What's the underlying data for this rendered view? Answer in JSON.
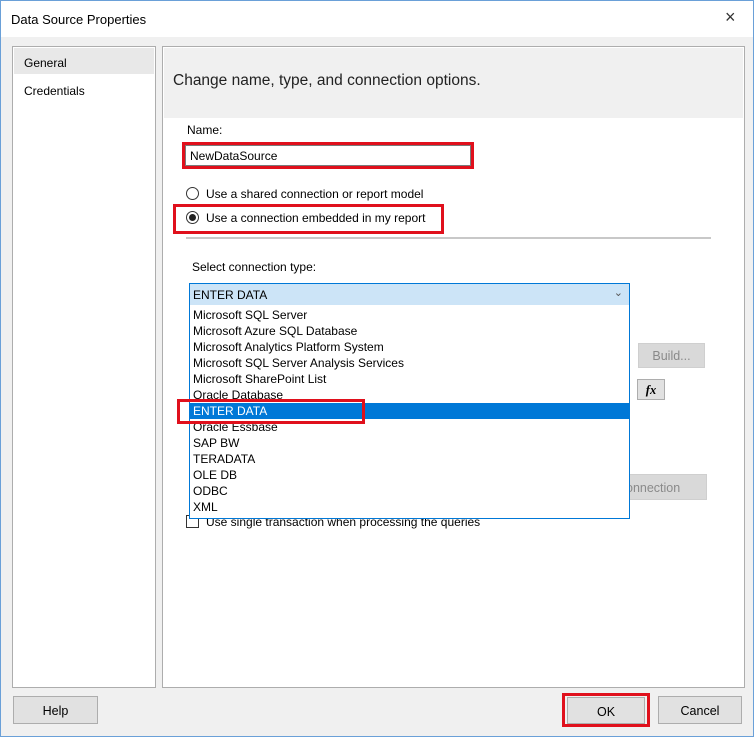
{
  "window": {
    "title": "Data Source Properties",
    "close_icon": "×"
  },
  "nav": {
    "items": [
      {
        "label": "General"
      },
      {
        "label": "Credentials"
      }
    ]
  },
  "header": {
    "text": "Change name, type, and connection options."
  },
  "name": {
    "label": "Name:",
    "value": "NewDataSource"
  },
  "radios": [
    {
      "label": "Use a shared connection or report model",
      "checked": false
    },
    {
      "label": "Use a connection embedded in my report",
      "checked": true
    }
  ],
  "connection": {
    "label": "Select connection type:",
    "selected": "ENTER DATA",
    "options": [
      "Microsoft SQL Server",
      "Microsoft Azure SQL Database",
      "Microsoft Analytics Platform System",
      "Microsoft SQL Server Analysis Services",
      "Microsoft SharePoint List",
      "Oracle Database",
      "ENTER DATA",
      "Oracle Essbase",
      "SAP BW",
      "TERADATA",
      "OLE DB",
      "ODBC",
      "XML"
    ]
  },
  "buttons": {
    "build": "Build...",
    "fx": "fx",
    "test_connection": "onnection",
    "help": "Help",
    "ok": "OK",
    "cancel": "Cancel"
  },
  "checkbox": {
    "label": "Use single transaction when processing the queries"
  }
}
